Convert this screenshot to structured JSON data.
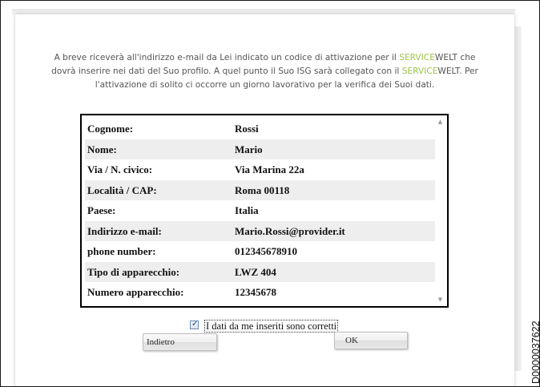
{
  "intro": {
    "line1_a": "A breve riceverà all'indirizzo e-mail da Lei indicato un codice di attivazione per il ",
    "line1_brand1": "SERVICE",
    "line1_brand2": "WELT",
    "line1_b": " che",
    "line2_a": "dovrà inserire nei dati del Suo profilo. A quel punto il Suo ISG sarà collegato con il ",
    "line2_brand1": "SERVICE",
    "line2_brand2": "WELT",
    "line2_b": ". Per",
    "line3": "l'attivazione di solito ci occorre un giorno lavorativo per la verifica dei Suoi dati."
  },
  "profile": {
    "rows": [
      {
        "label": "Cognome:",
        "value": "Rossi"
      },
      {
        "label": "Nome:",
        "value": "Mario"
      },
      {
        "label": "Via / N. civico:",
        "value": "Via Marina  22a"
      },
      {
        "label": "Località / CAP:",
        "value": "Roma  00118"
      },
      {
        "label": "Paese:",
        "value": "Italia"
      },
      {
        "label": "Indirizzo e-mail:",
        "value": "Mario.Rossi@provider.it"
      },
      {
        "label": "phone number:",
        "value": "012345678910"
      },
      {
        "label": "Tipo di apparecchio:",
        "value": "LWZ 404"
      },
      {
        "label": "Numero apparecchio:",
        "value": "12345678"
      }
    ]
  },
  "confirm": {
    "checked": true,
    "label": "I dati da me inseriti sono corretti"
  },
  "buttons": {
    "back_label": "Indietro",
    "ok_label": "OK"
  },
  "doc_id": "D0000037622",
  "colors": {
    "brand_service": "#9cc34a",
    "brand_welt": "#9cc34a",
    "row_alt": "#eeeeee"
  },
  "icons": {
    "scroll_up": "scroll-up-arrow-icon",
    "scroll_down": "scroll-down-arrow-icon",
    "checkmark": "checkmark-icon"
  }
}
